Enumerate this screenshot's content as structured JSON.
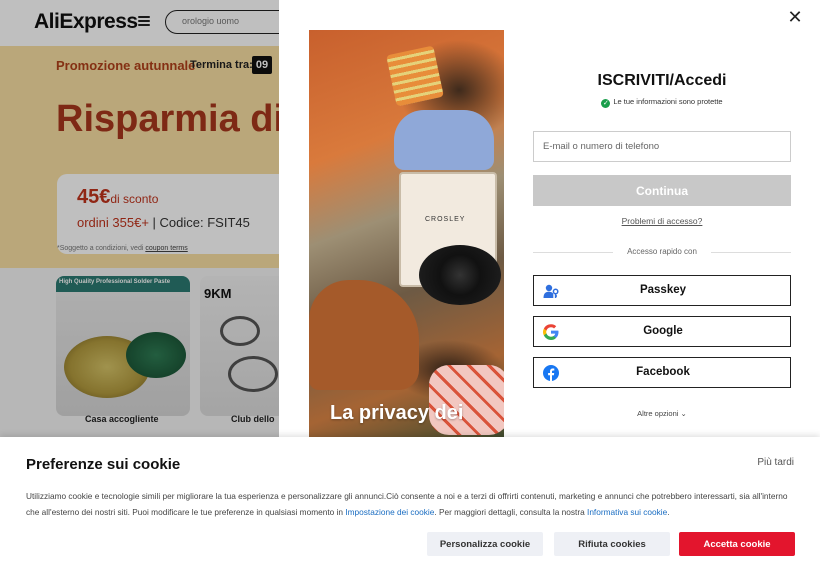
{
  "header": {
    "logo": "AliExpress",
    "search_value": "orologio uomo"
  },
  "hero": {
    "promo_title": "Promozione autunnale",
    "ends_label": "Termina tra:",
    "timer_hours": "09",
    "headline": "Risparmia di p",
    "coupon_amount": "45€",
    "coupon_amount_suffix": "di sconto",
    "coupon_min": "ordini 355€+",
    "coupon_code": "| Codice: FSIT45",
    "footnote_text": "*Soggetto a condizioni, vedi ",
    "footnote_link": "coupon terms"
  },
  "cards": [
    {
      "tag": "High Quality Professional Solder Paste",
      "caption": "Casa accogliente"
    },
    {
      "brand": "9KM",
      "caption": "Club dello"
    }
  ],
  "modal": {
    "close_symbol": "✕",
    "photo_caption": "La privacy dei",
    "photo_brand": "CROSLEY",
    "title": "ISCRIVITI/Accedi",
    "secure_text": "Le tue informazioni sono protette",
    "email_placeholder": "E-mail o numero di telefono",
    "continue_label": "Continua",
    "access_problems": "Problemi di accesso?",
    "quick_access": "Accesso rapido con",
    "social": [
      {
        "label": "Passkey",
        "icon": "passkey-icon",
        "color": "#2f6fde"
      },
      {
        "label": "Google",
        "icon": "google-icon"
      },
      {
        "label": "Facebook",
        "icon": "facebook-icon",
        "color": "#1877f2"
      }
    ],
    "more_options": "Altre opzioni ⌄"
  },
  "cookie": {
    "title": "Preferenze sui cookie",
    "later": "Più tardi",
    "text_part1": "Utilizziamo cookie e tecnologie simili per migliorare la tua esperienza e personalizzare gli annunci.Ciò consente a noi e a terzi di offrirti contenuti, marketing e annunci che potrebbero interessarti, sia all'interno che all'esterno dei nostri siti. Puoi modificare le tue preferenze in qualsiasi momento in ",
    "link_settings": "Impostazione dei cookie",
    "text_part2": ". Per maggiori dettagli, consulta la nostra ",
    "link_policy": "Informativa sui cookie",
    "text_part3": ".",
    "btn_customize": "Personalizza cookie",
    "btn_reject": "Rifiuta cookies",
    "btn_accept": "Accetta cookie",
    "accent": "#e3152d"
  }
}
